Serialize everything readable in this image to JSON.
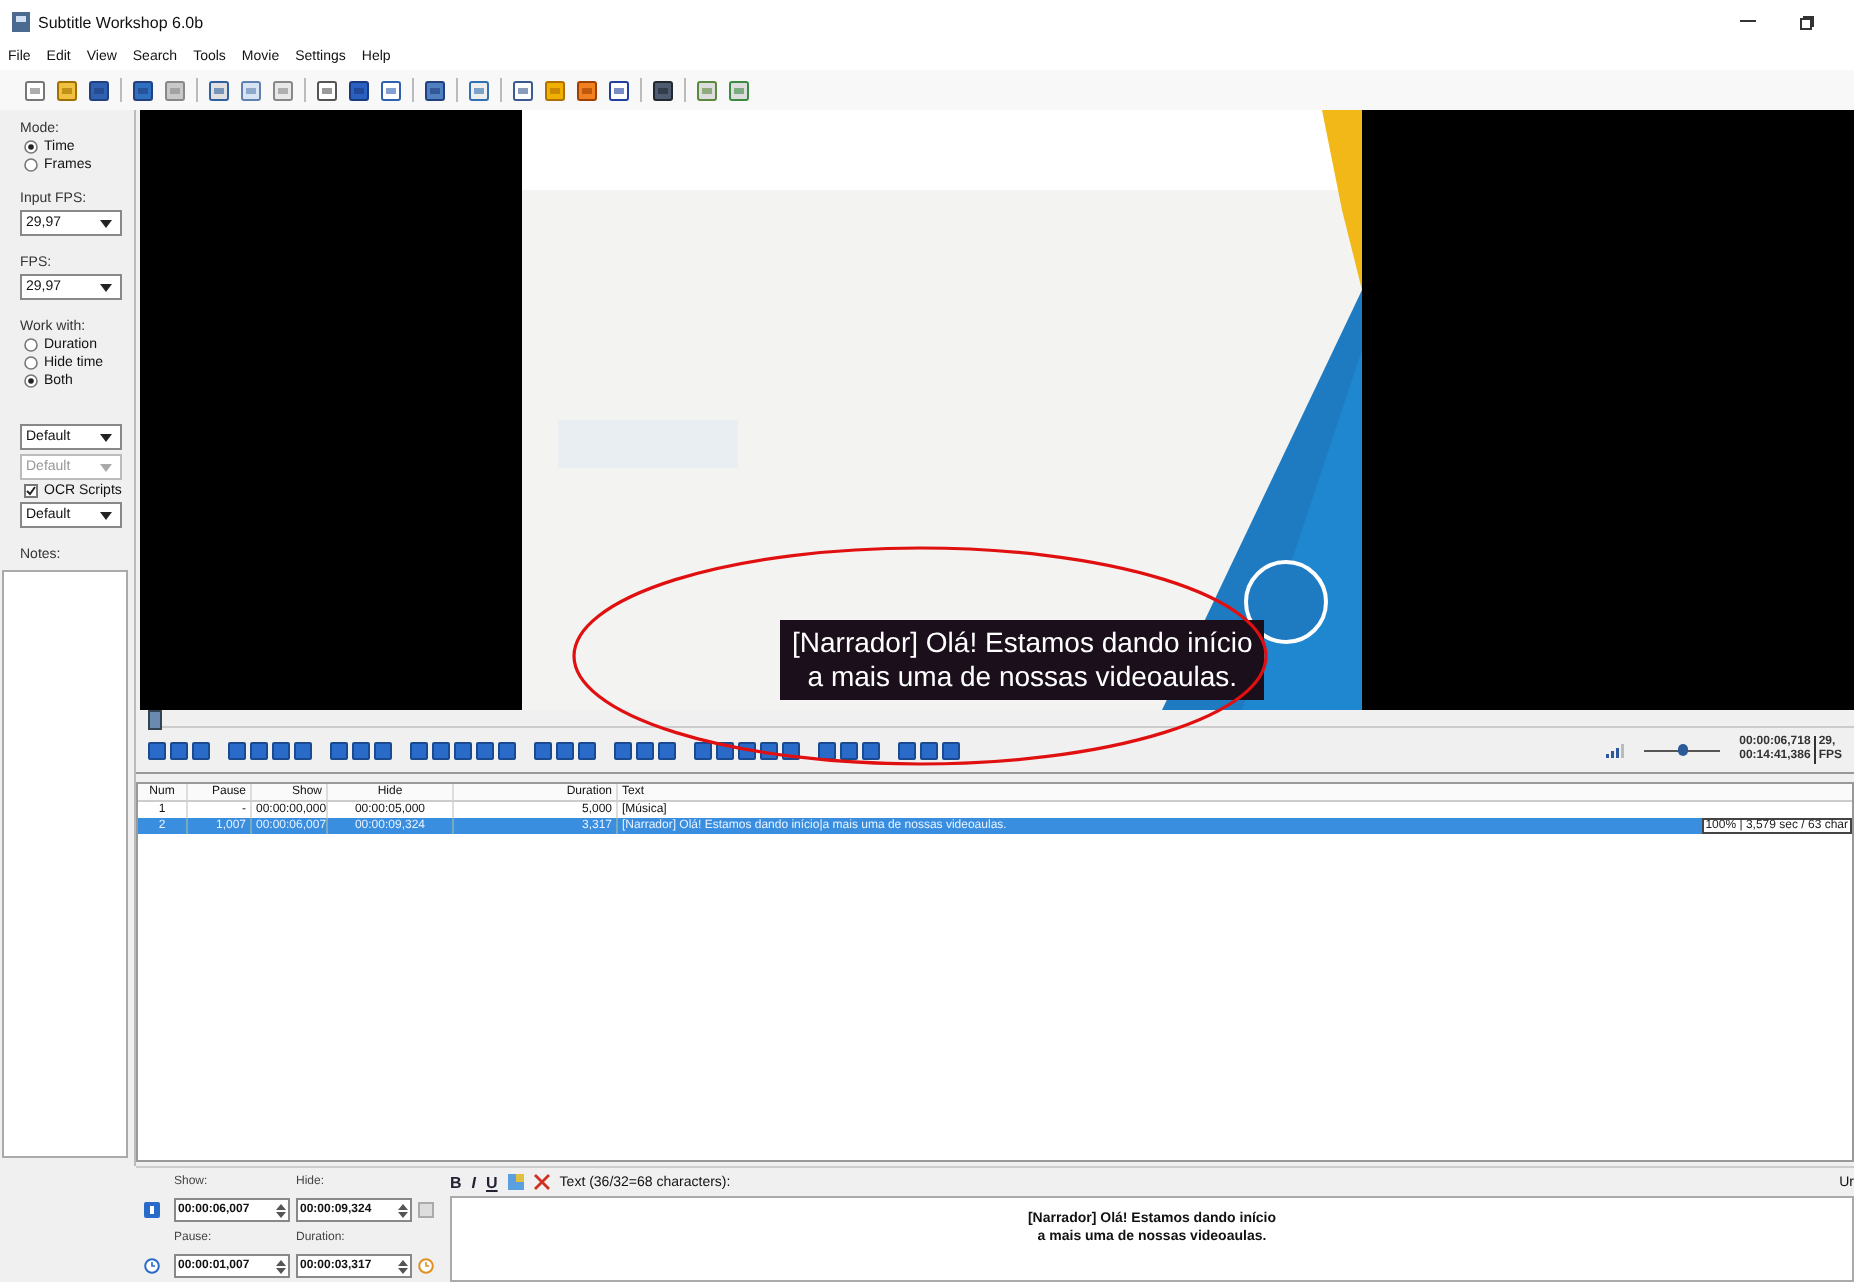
{
  "window": {
    "title": "Subtitle Workshop 6.0b"
  },
  "menu": [
    "File",
    "Edit",
    "View",
    "Search",
    "Tools",
    "Movie",
    "Settings",
    "Help"
  ],
  "sidebar": {
    "mode_label": "Mode:",
    "mode_options": [
      {
        "label": "Time",
        "selected": true
      },
      {
        "label": "Frames",
        "selected": false
      }
    ],
    "input_fps_label": "Input FPS:",
    "input_fps": "29,97",
    "fps_label": "FPS:",
    "fps": "29,97",
    "work_with_label": "Work with:",
    "work_with_options": [
      {
        "label": "Duration",
        "selected": false
      },
      {
        "label": "Hide time",
        "selected": false
      },
      {
        "label": "Both",
        "selected": true
      }
    ],
    "dropdowns": [
      {
        "value": "Default",
        "disabled": false
      },
      {
        "value": "Default",
        "disabled": true
      }
    ],
    "ocr_scripts": {
      "label": "OCR Scripts",
      "checked": true
    },
    "ocr_dropdown": "Default",
    "notes_label": "Notes:"
  },
  "video": {
    "subtitle_lines": [
      "[Narrador] Olá! Estamos dando início",
      "a mais uma de nossas videoaulas."
    ]
  },
  "player": {
    "seek": {
      "level": 0.0
    },
    "volume": {
      "level": 0.5
    },
    "time_current": "00:00:06,718",
    "time_total": "00:14:41,386",
    "fps_value": "29,",
    "fps_label": "FPS"
  },
  "table": {
    "columns": [
      "Num",
      "Pause",
      "Show",
      "Hide",
      "Duration",
      "Text"
    ],
    "rows": [
      {
        "cells": [
          "1",
          "-",
          "00:00:00,000",
          "00:00:05,000",
          "5,000",
          "[Música]"
        ],
        "selected": false
      },
      {
        "cells": [
          "2",
          "1,007",
          "00:00:06,007",
          "00:00:09,324",
          "3,317",
          "[Narrador] Olá! Estamos dando início|a mais uma de nossas videoaulas."
        ],
        "selected": true,
        "info": "100% | 3,579 sec / 63 char"
      }
    ]
  },
  "editor": {
    "show_label": "Show:",
    "show": "00:00:06,007",
    "hide_label": "Hide:",
    "hide": "00:00:09,324",
    "pause_label": "Pause:",
    "pause": "00:00:01,007",
    "duration_label": "Duration:",
    "duration": "00:00:03,317",
    "format_buttons": [
      "B",
      "I",
      "U"
    ],
    "text_label": "Text (36/32=68 characters):",
    "right_label": "Ur",
    "text_lines": [
      "[Narrador] Olá! Estamos dando início",
      "a mais uma de nossas videoaulas."
    ]
  }
}
